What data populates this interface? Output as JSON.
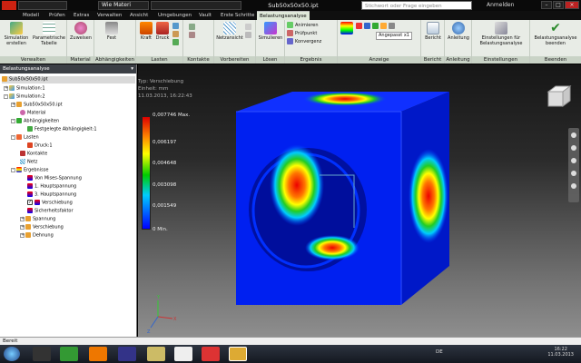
{
  "title_bar": {
    "material": "Wie Materi",
    "document_title": "Sub50x50x50.ipt",
    "search_placeholder": "Stichwort oder Frage eingeben",
    "login": "Anmelden"
  },
  "tabs": [
    "Modell",
    "Prüfen",
    "Extras",
    "Verwalten",
    "Ansicht",
    "Umgebungen",
    "Vault",
    "Erste Schritte",
    "Belastungsanalyse"
  ],
  "ribbon": {
    "panels": [
      "Verwalten",
      "Material",
      "Abhängigkeiten",
      "Lasten",
      "Kontakte",
      "Vorbereiten",
      "Lösen",
      "Ergebnis",
      "Anzeige",
      "Bericht",
      "Anleitung",
      "Einstellungen",
      "Beenden"
    ],
    "buttons": {
      "simulation_create": "Simulation erstellen",
      "param_table": "Parametrische Tabelle",
      "assign": "Zuweisen",
      "fixed": "Fest",
      "force": "Kraft",
      "pressure": "Druck",
      "mesh_view": "Netzansicht",
      "simulate": "Simulieren",
      "animate": "Animieren",
      "probe": "Prüfpunkt",
      "convergence": "Konvergenz",
      "adjusted": "Angepasst x1",
      "report": "Bericht",
      "guide": "Anleitung",
      "settings": "Einstellungen für Belastungsanalyse",
      "finish": "Belastungsanalyse beenden"
    }
  },
  "browser": {
    "title": "Belastungsanalyse",
    "items": [
      {
        "label": "Sub50x50x50.ipt"
      },
      {
        "label": "Simulation:1"
      },
      {
        "label": "Simulation:2"
      },
      {
        "label": "Sub50x50x50.ipt"
      },
      {
        "label": "Material"
      },
      {
        "label": "Abhängigkeiten"
      },
      {
        "label": "Festgelegte Abhängigkeit:1"
      },
      {
        "label": "Lasten"
      },
      {
        "label": "Druck:1"
      },
      {
        "label": "Kontakte"
      },
      {
        "label": "Netz"
      },
      {
        "label": "Ergebnisse"
      },
      {
        "label": "Von Mises-Spannung"
      },
      {
        "label": "1. Hauptspannung"
      },
      {
        "label": "3. Hauptspannung"
      },
      {
        "label": "Verschiebung"
      },
      {
        "label": "Sicherheitsfaktor"
      },
      {
        "label": "Spannung"
      },
      {
        "label": "Verschiebung"
      },
      {
        "label": "Dehnung"
      }
    ]
  },
  "legend": {
    "type_line": "Typ: Verschiebung",
    "unit_line": "Einheit: mm",
    "date_line": "11.03.2013, 16:22:43",
    "max_value": 0.007746,
    "max_label": "0,007746 Max.",
    "ticks": [
      "0,006197",
      "0,004648",
      "0,003098",
      "0,001549"
    ],
    "min_label": "0 Min."
  },
  "colors": {
    "ribbon_bg": "#e8ece6",
    "accent_green": "#2e8b2e",
    "fea_low": "#0000ff",
    "fea_high": "#ff0000"
  },
  "status": {
    "text": "Bereit"
  },
  "taskbar": {
    "lang": "DE",
    "time": "16:22",
    "date": "11.03.2013"
  }
}
